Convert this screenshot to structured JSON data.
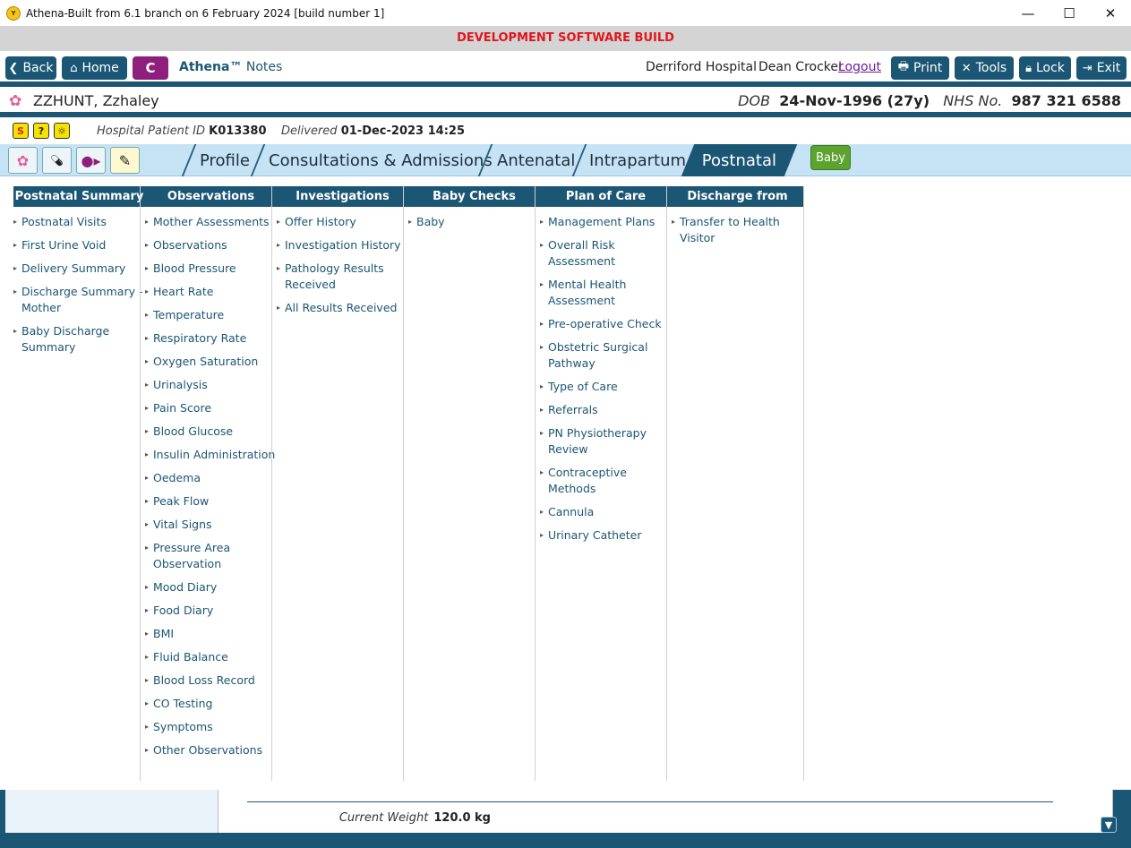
{
  "window": {
    "title": "Athena-Built from 6.1 branch on 6 February 2024 [build number 1]",
    "controls": [
      "—",
      "☐",
      "✕"
    ]
  },
  "dev_banner": "DEVELOPMENT SOFTWARE BUILD",
  "nav": {
    "back": "Back",
    "home": "Home",
    "c": "C",
    "app_name": "Athena™",
    "app_sub": "Notes",
    "hospital": "Derriford Hospital",
    "user": "Dean Crocker",
    "logout": "Logout",
    "print": "Print",
    "tools": "Tools",
    "lock": "Lock",
    "exit": "Exit"
  },
  "patient": {
    "name": "ZZHUNT, Zzhaley",
    "dob_label": "DOB",
    "dob": "24-Nov-1996 (27y)",
    "nhs_label": "NHS No.",
    "nhs": "987 321 6588",
    "hospital_id_label": "Hospital Patient ID",
    "hospital_id": "K013380",
    "delivered_label": "Delivered",
    "delivered": "01-Dec-2023 14:25"
  },
  "tabs": [
    "Profile",
    "Consultations & Admissions",
    "Antenatal",
    "Intrapartum",
    "Postnatal"
  ],
  "active_tab": "Postnatal",
  "baby_button": "Baby",
  "menu": {
    "postnatal_summary": {
      "title": "Postnatal Summary",
      "items": [
        "Postnatal Visits",
        "First Urine Void",
        "Delivery Summary",
        "Discharge Summary - Mother",
        "Baby Discharge Summary"
      ]
    },
    "observations": {
      "title": "Observations",
      "items": [
        "Mother Assessments",
        "Observations",
        "Blood Pressure",
        "Heart Rate",
        "Temperature",
        "Respiratory Rate",
        "Oxygen Saturation",
        "Urinalysis",
        "Pain Score",
        "Blood Glucose",
        "Insulin Administration",
        "Oedema",
        "Peak Flow",
        "Vital Signs",
        "Pressure Area Observation",
        "Mood Diary",
        "Food Diary",
        "BMI",
        "Fluid Balance",
        "Blood Loss Record",
        "CO Testing",
        "Symptoms",
        "Other Observations"
      ]
    },
    "investigations": {
      "title": "Investigations",
      "items": [
        "Offer History",
        "Investigation History",
        "Pathology Results Received",
        "All Results Received"
      ]
    },
    "baby_checks": {
      "title": "Baby Checks",
      "items": [
        "Baby"
      ]
    },
    "plan_of_care": {
      "title": "Plan of Care",
      "items": [
        "Management Plans",
        "Overall Risk Assessment",
        "Mental Health Assessment",
        "Pre-operative Check",
        "Obstetric Surgical Pathway",
        "Type of Care",
        "Referrals",
        "PN Physiotherapy Review",
        "Contraceptive Methods",
        "Cannula",
        "Urinary Catheter"
      ]
    },
    "discharge": {
      "title": "Discharge from Care",
      "items": [
        "Transfer to Health Visitor"
      ]
    }
  },
  "background": {
    "current_weight_label": "Current Weight",
    "current_weight": "120.0 kg"
  }
}
